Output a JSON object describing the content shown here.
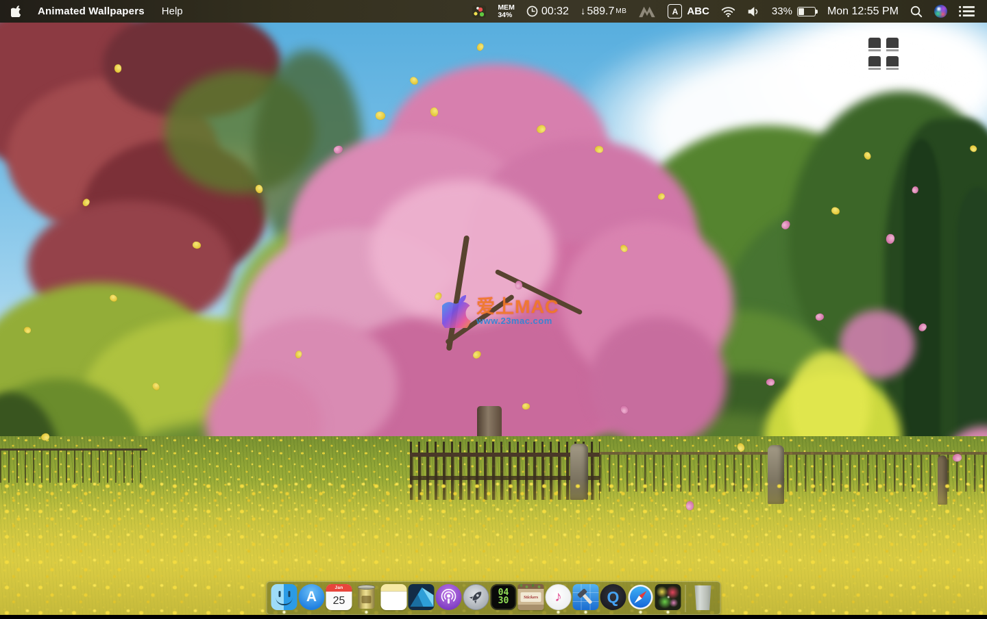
{
  "menu_bar": {
    "app_name": "Animated Wallpapers",
    "menus": [
      {
        "label": "Help"
      }
    ],
    "status": {
      "memory": {
        "label": "MEM",
        "value": "34%"
      },
      "timer": "00:32",
      "download": {
        "arrow": "↓",
        "value": "589.7",
        "unit": "MB"
      },
      "input_source": {
        "key": "A",
        "label": "ABC"
      },
      "battery_percent": "33%",
      "clock": "Mon 12:55 PM"
    },
    "icons": [
      "apple-logo",
      "confetti",
      "clock",
      "mountain-m",
      "wifi",
      "volume",
      "battery",
      "spotlight-search",
      "siri",
      "notification-list"
    ]
  },
  "desktop": {
    "watermark": {
      "title": "爱上MAC",
      "subtitle": "www.23mac.com"
    },
    "widget_grid_icon": "window-grid"
  },
  "dock": {
    "items": [
      {
        "name": "finder",
        "running": true
      },
      {
        "name": "app-store",
        "running": false,
        "letter": "A"
      },
      {
        "name": "calendar",
        "running": false,
        "month": "Jan",
        "day": "25"
      },
      {
        "name": "tin-can-app",
        "running": true
      },
      {
        "name": "notes",
        "running": false
      },
      {
        "name": "affinity-designer",
        "running": false
      },
      {
        "name": "podcasts",
        "running": false
      },
      {
        "name": "launchpad-rocket",
        "running": false
      },
      {
        "name": "watch-timer",
        "running": false,
        "top": "04",
        "bottom": "30"
      },
      {
        "name": "stickers",
        "running": false,
        "label": "Stickers"
      },
      {
        "name": "itunes",
        "running": true,
        "glyph": "♪"
      },
      {
        "name": "xcode",
        "running": true
      },
      {
        "name": "quicktime",
        "running": false,
        "letter": "Q"
      },
      {
        "name": "safari",
        "running": true
      },
      {
        "name": "animated-wallpapers",
        "running": true
      },
      {
        "name": "trash",
        "running": false
      }
    ]
  }
}
